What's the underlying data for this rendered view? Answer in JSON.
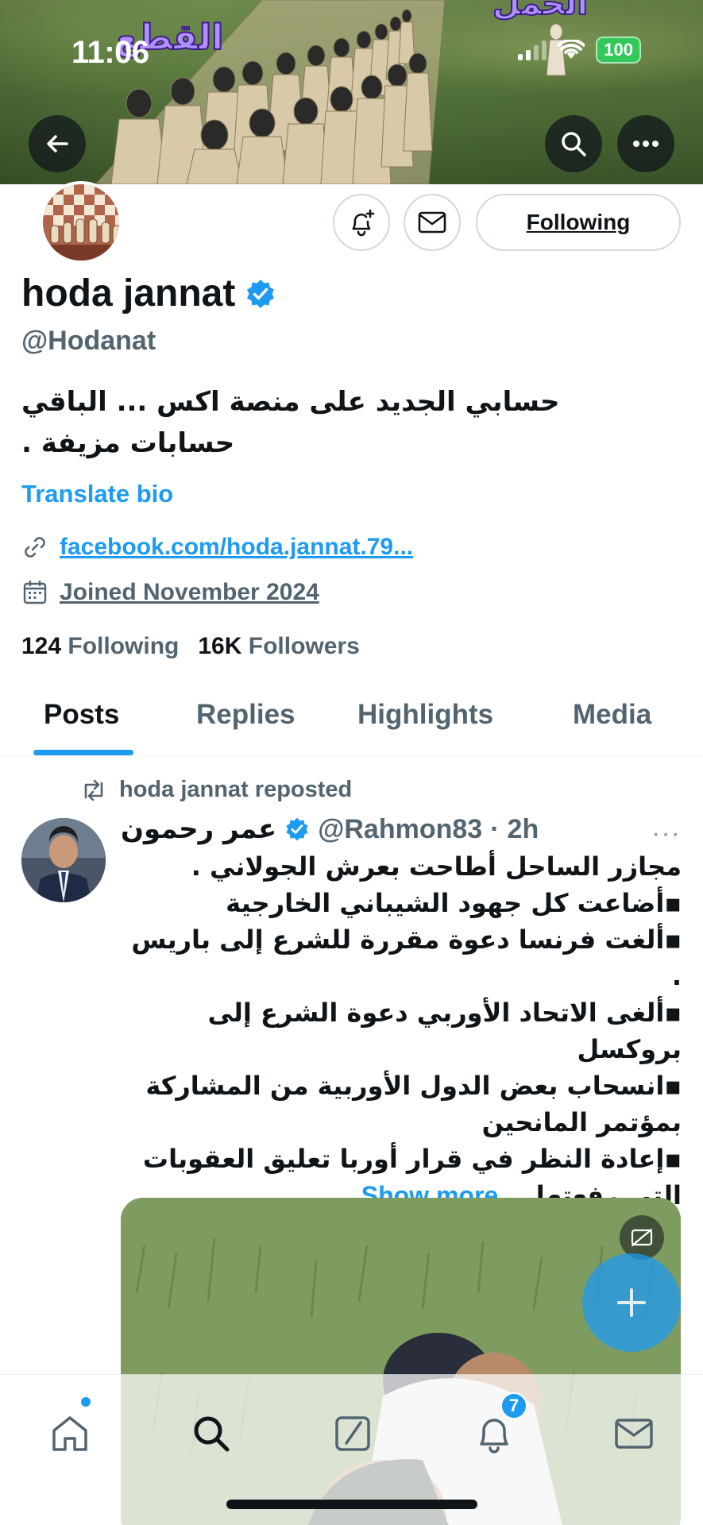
{
  "status_bar": {
    "time": "11:06",
    "battery": "100"
  },
  "banner": {
    "overlay_text_1": "القطع",
    "overlay_text_2": "الحمل"
  },
  "profile": {
    "display_name": "hoda jannat",
    "handle": "@Hodanat",
    "bio": "حسابي الجديد على منصة اكس ... الباقي حسابات مزيفة .",
    "translate_label": "Translate bio",
    "link": "facebook.com/hoda.jannat.79...",
    "joined": "Joined November 2024",
    "following_count": "124",
    "following_label": "Following",
    "followers_count": "16K",
    "followers_label": "Followers",
    "follow_button": "Following"
  },
  "tabs": [
    {
      "label": "Posts",
      "active": true
    },
    {
      "label": "Replies",
      "active": false
    },
    {
      "label": "Highlights",
      "active": false
    },
    {
      "label": "Media",
      "active": false
    }
  ],
  "post": {
    "repost_label": "hoda jannat reposted",
    "author_name": "عمر رحمون",
    "author_handle": "@Rahmon83",
    "separator": "·",
    "time": "2h",
    "more": "···",
    "lines": [
      "مجازر الساحل أطاحت بعرش الجولاني .",
      "▪أضاعت كل جهود الشيباني الخارجية",
      "▪ألغت فرنسا دعوة مقررة للشرع إلى باريس .",
      "▪ألغى الاتحاد الأوربي دعوة الشرع إلى بروكسل",
      "▪انسحاب بعض الدول الأوربية من المشاركة بمؤتمر المانحين",
      "▪إعادة النظر في قرار أوربا تعليق العقوبات"
    ],
    "last_line": "التي رفعتها...",
    "show_more": "Show more"
  },
  "bottom_nav": {
    "notifications_badge": "7"
  },
  "colors": {
    "accent": "#1d9bf0",
    "text": "#0f1419",
    "secondary": "#536471",
    "verified": "#1d9bf0"
  }
}
